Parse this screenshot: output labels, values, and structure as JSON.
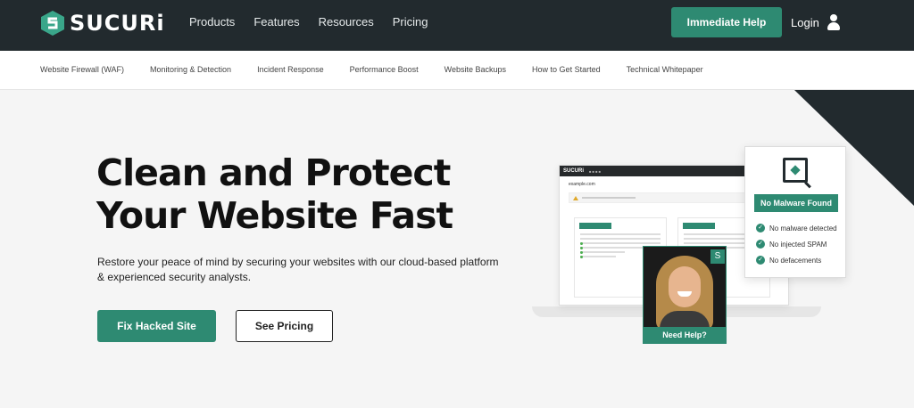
{
  "header": {
    "logo_text": "SUCURi",
    "nav": [
      "Products",
      "Features",
      "Resources",
      "Pricing"
    ],
    "help_button": "Immediate Help",
    "login": "Login"
  },
  "subnav": {
    "items": [
      "Website Firewall (WAF)",
      "Monitoring & Detection",
      "Incident Response",
      "Performance Boost",
      "Website Backups",
      "How to Get Started",
      "Technical Whitepaper"
    ]
  },
  "hero": {
    "title": "Clean and Protect Your Website Fast",
    "subtitle": "Restore your peace of mind by securing your websites with our cloud-based platform & experienced security analysts.",
    "primary_button": "Fix Hacked Site",
    "secondary_button": "See Pricing"
  },
  "dashboard": {
    "site": "example.com"
  },
  "status_card": {
    "badge": "No Malware Found",
    "checks": [
      "No malware detected",
      "No injected SPAM",
      "No defacements"
    ]
  },
  "support": {
    "label": "Need Help?"
  },
  "colors": {
    "brand_green": "#2e8a72",
    "dark": "#222a2e"
  }
}
